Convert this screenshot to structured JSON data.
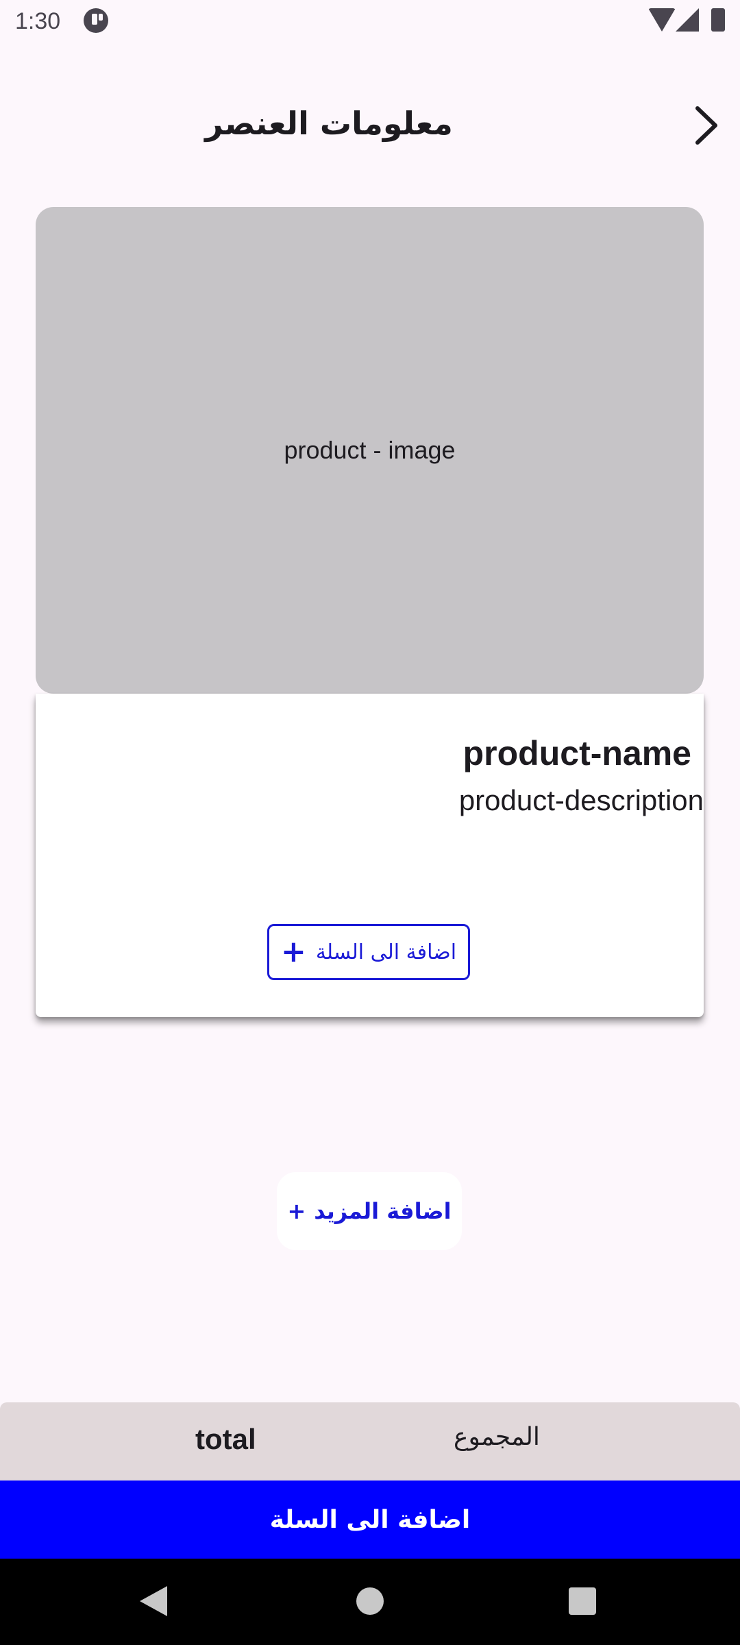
{
  "status_bar": {
    "time": "1:30"
  },
  "app_bar": {
    "title": "معلومات العنصر"
  },
  "product": {
    "image_label": "product - image",
    "name": "product-name",
    "description": "product-description",
    "add_to_cart_label": "اضافة الى السلة",
    "add_to_cart_icon": "+"
  },
  "add_more": {
    "label": "اضافة المزيد",
    "icon": "+"
  },
  "summary": {
    "total_label": "المجموع",
    "total_value": "total"
  },
  "primary_action": {
    "label": "اضافة الى السلة"
  },
  "colors": {
    "accent": "#1a1ad6",
    "primary_button": "#0000ff",
    "background": "#fdf7fc",
    "image_placeholder": "#c6c4c7",
    "total_bar": "#e1d8da"
  },
  "icons": {
    "back": "chevron-right-icon",
    "nav_back": "triangle-back-icon",
    "nav_home": "circle-home-icon",
    "nav_recents": "square-recents-icon"
  }
}
